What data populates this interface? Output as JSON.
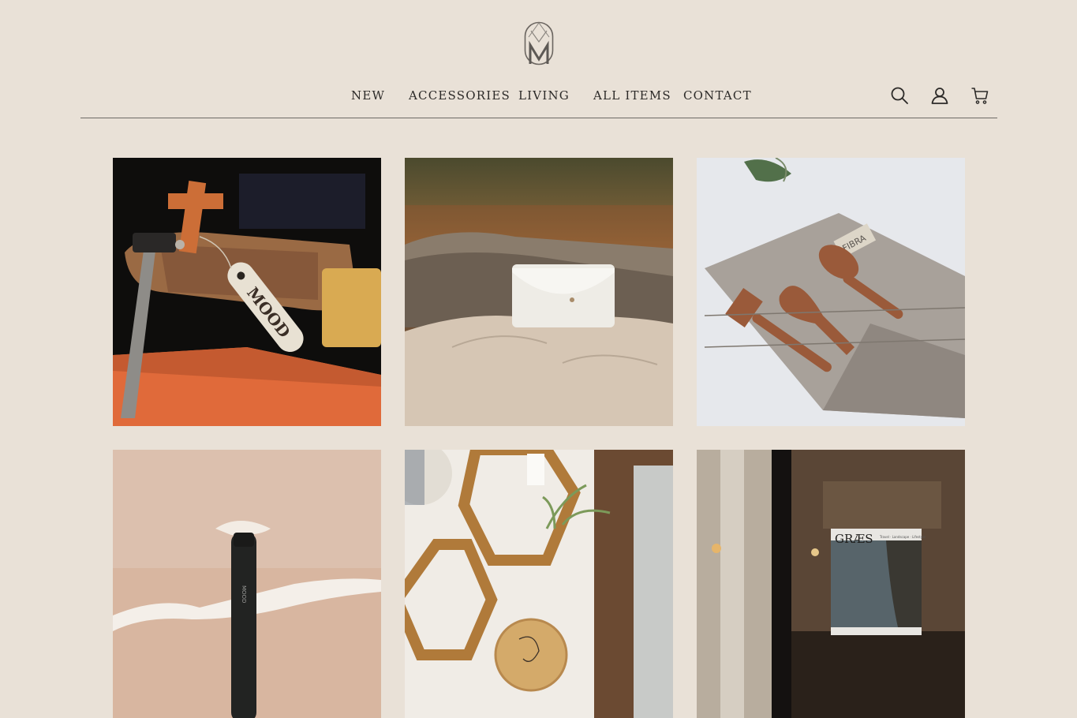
{
  "brand": {
    "logo_icon": "m-monogram-logo"
  },
  "nav": {
    "items": [
      {
        "label": "NEW"
      },
      {
        "label": "ACCESSORIES"
      },
      {
        "label": "LIVING"
      },
      {
        "label": "ALL ITEMS"
      },
      {
        "label": "CONTACT"
      }
    ]
  },
  "header_icons": {
    "search": "search-icon",
    "account": "user-icon",
    "cart": "cart-icon"
  },
  "products": [
    {
      "image": "leather-pouch-with-mood-tag",
      "tag_text": "MOOD"
    },
    {
      "image": "white-hide-pouch-on-driftwood"
    },
    {
      "image": "coconut-wood-cutlery-on-linen-wrap",
      "label_text": "FIBRA"
    },
    {
      "image": "black-bottle-on-beach-sand",
      "bottle_text": "MOOD"
    },
    {
      "image": "hexagon-shelves-with-air-plant"
    },
    {
      "image": "graes-book-on-wooden-shelf",
      "book_title": "GRÆS",
      "book_subtitle": "Travel · Landscape · Lifestyle"
    }
  ],
  "colors": {
    "background": "#e9e1d7",
    "text": "#2c2a28",
    "divider": "#6e6a66"
  }
}
